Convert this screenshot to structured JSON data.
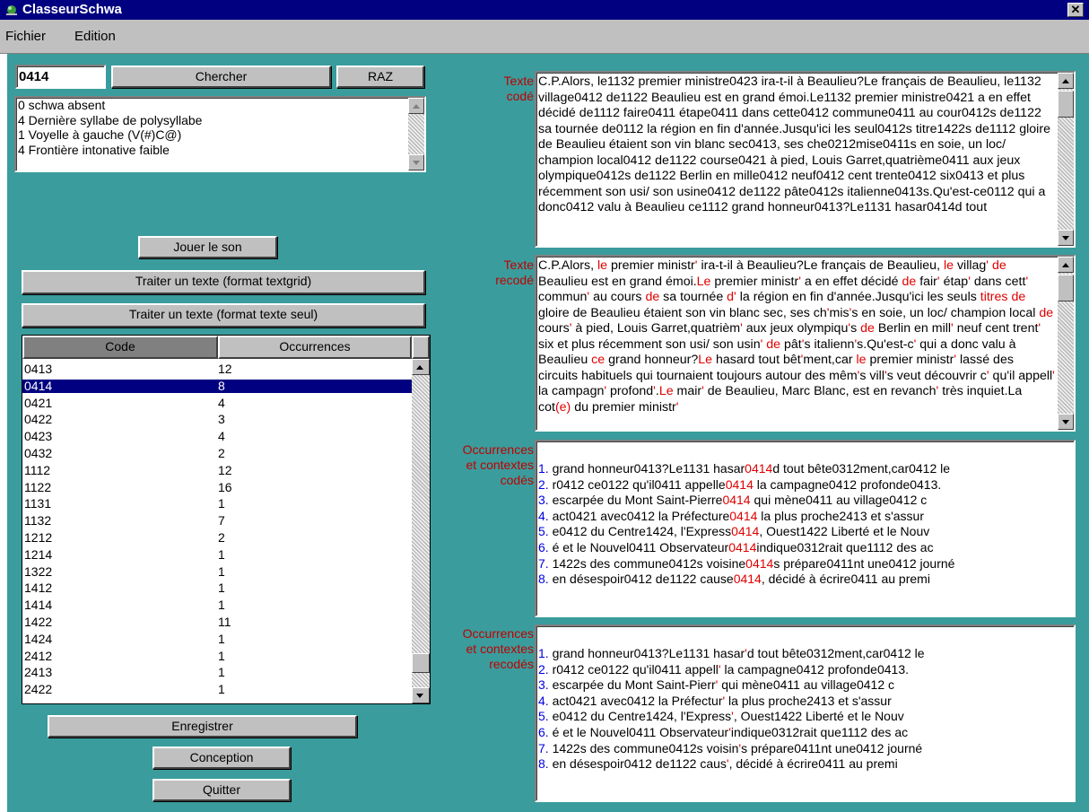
{
  "window": {
    "title": "ClasseurSchwa",
    "close_glyph": "✕"
  },
  "menu": [
    "Fichier",
    "Edition"
  ],
  "search": {
    "code_value": "0414",
    "search_label": "Chercher",
    "reset_label": "RAZ",
    "results": [
      "0 schwa absent",
      "4 Dernière syllabe de polysyllabe",
      "1 Voyelle à gauche (V(#)C@)",
      "4 Frontière intonative faible"
    ]
  },
  "buttons": {
    "play": "Jouer le son",
    "process_textgrid": "Traiter un texte (format textgrid)",
    "process_plain": "Traiter un texte (format texte seul)",
    "save": "Enregistrer",
    "design": "Conception",
    "quit": "Quitter"
  },
  "grid": {
    "headers": [
      "Code",
      "Occurrences"
    ],
    "selected_index": 1,
    "rows": [
      [
        "0413",
        "12"
      ],
      [
        "0414",
        "8"
      ],
      [
        "0421",
        "4"
      ],
      [
        "0422",
        "3"
      ],
      [
        "0423",
        "4"
      ],
      [
        "0432",
        "2"
      ],
      [
        "1112",
        "12"
      ],
      [
        "1122",
        "16"
      ],
      [
        "1131",
        "1"
      ],
      [
        "1132",
        "7"
      ],
      [
        "1212",
        "2"
      ],
      [
        "1214",
        "1"
      ],
      [
        "1322",
        "1"
      ],
      [
        "1412",
        "1"
      ],
      [
        "1414",
        "1"
      ],
      [
        "1422",
        "11"
      ],
      [
        "1424",
        "1"
      ],
      [
        "2412",
        "1"
      ],
      [
        "2413",
        "1"
      ],
      [
        "2422",
        "1"
      ]
    ]
  },
  "labels": {
    "coded_text": [
      "Texte",
      "codé"
    ],
    "recoded_text": [
      "Texte",
      "recodé"
    ],
    "coded_occ": [
      "Occurrences",
      "et contextes",
      "codés"
    ],
    "recoded_occ": [
      "Occurrences",
      "et contextes",
      "recodés"
    ]
  },
  "coded_text": "C.P.Alors, le1132 premier ministre0423 ira-t-il à Beaulieu?Le français de Beaulieu, le1132 village0412 de1122 Beaulieu est en grand émoi.Le1132 premier ministre0421 a en effet décidé de1112 faire0411 étape0411 dans cette0412 commune0411 au cour0412s de1122 sa tournée de0112 la région en fin d'année.Jusqu'ici les seul0412s titre1422s de1112 gloire de Beaulieu étaient son vin blanc sec0413, ses che0212mise0411s en soie, un loc/ champion local0412 de1122 course0421 à pied, Louis Garret,quatrième0411 aux jeux olympique0412s de1122 Berlin en mille0412 neuf0412 cent trente0412 six0413 et plus récemment son usi/ son usine0412 de1122 pâte0412s italienne0413s.Qu'est-ce0112 qui a donc0412 valu à Beaulieu ce1112 grand honneur0413?Le1131 hasar0414d tout",
  "recoded_text": [
    {
      "t": "C.P.Alors, "
    },
    {
      "t": "le",
      "r": 1
    },
    {
      "t": "  premier ministr"
    },
    {
      "t": "'",
      "r": 1
    },
    {
      "t": " ira-t-il à Beaulieu?Le français de Beaulieu, "
    },
    {
      "t": "le",
      "r": 1
    },
    {
      "t": "  villag"
    },
    {
      "t": "'",
      "r": 1
    },
    {
      "t": " "
    },
    {
      "t": "de",
      "r": 1
    },
    {
      "t": " Beaulieu est en grand émoi."
    },
    {
      "t": "Le",
      "r": 1
    },
    {
      "t": " premier ministr"
    },
    {
      "t": "'",
      "r": 1
    },
    {
      "t": " a en effet décidé "
    },
    {
      "t": "de",
      "r": 1
    },
    {
      "t": " fair"
    },
    {
      "t": "'",
      "r": 1
    },
    {
      "t": " étap"
    },
    {
      "t": "'",
      "r": 1
    },
    {
      "t": " dans cett"
    },
    {
      "t": "'",
      "r": 1
    },
    {
      "t": " commun"
    },
    {
      "t": "'",
      "r": 1
    },
    {
      "t": " au cours "
    },
    {
      "t": "de",
      "r": 1
    },
    {
      "t": " sa tournée "
    },
    {
      "t": "d'",
      "r": 1
    },
    {
      "t": " la région en fin d'année.Jusqu'ici les seuls "
    },
    {
      "t": "titres",
      "r": 1
    },
    {
      "t": " "
    },
    {
      "t": "de",
      "r": 1
    },
    {
      "t": " gloire de Beaulieu étaient son vin blanc sec, ses ch"
    },
    {
      "t": "'",
      "r": 1
    },
    {
      "t": "mis"
    },
    {
      "t": "'",
      "r": 1
    },
    {
      "t": "s en soie, un loc/ champion local "
    },
    {
      "t": "de",
      "r": 1
    },
    {
      "t": " cours"
    },
    {
      "t": "'",
      "r": 1
    },
    {
      "t": " à pied, Louis Garret,quatrièm"
    },
    {
      "t": "'",
      "r": 1
    },
    {
      "t": " aux jeux olympiqu"
    },
    {
      "t": "'",
      "r": 1
    },
    {
      "t": "s "
    },
    {
      "t": "de",
      "r": 1
    },
    {
      "t": " Berlin en mill"
    },
    {
      "t": "'",
      "r": 1
    },
    {
      "t": " neuf cent trent"
    },
    {
      "t": "'",
      "r": 1
    },
    {
      "t": " six et plus récemment son usi/ son usin"
    },
    {
      "t": "'",
      "r": 1
    },
    {
      "t": " "
    },
    {
      "t": "de",
      "r": 1
    },
    {
      "t": " pât"
    },
    {
      "t": "'",
      "r": 1
    },
    {
      "t": "s italienn"
    },
    {
      "t": "'",
      "r": 1
    },
    {
      "t": "s.Qu'est-c"
    },
    {
      "t": "'",
      "r": 1
    },
    {
      "t": " qui a donc valu à Beaulieu "
    },
    {
      "t": "ce",
      "r": 1
    },
    {
      "t": " grand honneur?"
    },
    {
      "t": "Le",
      "r": 1
    },
    {
      "t": " hasard tout bêt"
    },
    {
      "t": "'",
      "r": 1
    },
    {
      "t": "ment,car "
    },
    {
      "t": "le",
      "r": 1
    },
    {
      "t": " premier ministr"
    },
    {
      "t": "'",
      "r": 1
    },
    {
      "t": " lassé des circuits habituels qui tournaient toujours autour des mêm"
    },
    {
      "t": "'",
      "r": 1
    },
    {
      "t": "s vill"
    },
    {
      "t": "'",
      "r": 1
    },
    {
      "t": "s veut découvrir c"
    },
    {
      "t": "'",
      "r": 1
    },
    {
      "t": " qu'il appell"
    },
    {
      "t": "'",
      "r": 1
    },
    {
      "t": " la campagn"
    },
    {
      "t": "'",
      "r": 1
    },
    {
      "t": " profond"
    },
    {
      "t": "'",
      "r": 1
    },
    {
      "t": "."
    },
    {
      "t": "Le",
      "r": 1
    },
    {
      "t": " mair"
    },
    {
      "t": "'",
      "r": 1
    },
    {
      "t": " de Beaulieu, Marc Blanc, est en revanch"
    },
    {
      "t": "'",
      "r": 1
    },
    {
      "t": " très inquiet.La cot"
    },
    {
      "t": "(e)",
      "r": 1
    },
    {
      "t": " du premier ministr"
    },
    {
      "t": "'",
      "r": 1
    }
  ],
  "coded_occurrences": [
    [
      {
        "t": "1.",
        "b": 1
      },
      {
        "t": " grand honneur0413?Le1131 hasar"
      },
      {
        "t": "0414",
        "r": 1
      },
      {
        "t": "d tout bête0312ment,car0412 le"
      }
    ],
    [
      {
        "t": "2.",
        "b": 1
      },
      {
        "t": " r0412 ce0122 qu'il0411 appelle"
      },
      {
        "t": "0414",
        "r": 1
      },
      {
        "t": " la campagne0412 profonde0413."
      }
    ],
    [
      {
        "t": "3.",
        "b": 1
      },
      {
        "t": "  escarpée du Mont Saint-Pierre"
      },
      {
        "t": "0414",
        "r": 1
      },
      {
        "t": " qui mène0411 au village0412 c"
      }
    ],
    [
      {
        "t": "4.",
        "b": 1
      },
      {
        "t": " act0421 avec0412 la Préfecture"
      },
      {
        "t": "0414",
        "r": 1
      },
      {
        "t": " la plus proche2413 et s'assur"
      }
    ],
    [
      {
        "t": "5.",
        "b": 1
      },
      {
        "t": " e0412 du Centre1424, l'Express"
      },
      {
        "t": "0414",
        "r": 1
      },
      {
        "t": ", Ouest1422 Liberté et le Nouv"
      }
    ],
    [
      {
        "t": "6.",
        "b": 1
      },
      {
        "t": " é et le Nouvel0411 Observateur"
      },
      {
        "t": "0414",
        "r": 1
      },
      {
        "t": "indique0312rait que1112 des ac"
      }
    ],
    [
      {
        "t": "7.",
        "b": 1
      },
      {
        "t": " 1422s des commune0412s voisine"
      },
      {
        "t": "0414",
        "r": 1
      },
      {
        "t": "s prépare0411nt une0412 journé"
      }
    ],
    [
      {
        "t": "8.",
        "b": 1
      },
      {
        "t": "  en désespoir0412 de1122 cause"
      },
      {
        "t": "0414",
        "r": 1
      },
      {
        "t": ", décidé à écrire0411 au premi"
      }
    ]
  ],
  "recoded_occurrences": [
    [
      {
        "t": "1.",
        "b": 1
      },
      {
        "t": " grand honneur0413?Le1131 hasar"
      },
      {
        "t": "'",
        "r": 1
      },
      {
        "t": "d tout bête0312ment,car0412 le"
      }
    ],
    [
      {
        "t": "2.",
        "b": 1
      },
      {
        "t": " r0412 ce0122 qu'il0411 appell"
      },
      {
        "t": "'",
        "r": 1
      },
      {
        "t": " la campagne0412 profonde0413."
      }
    ],
    [
      {
        "t": "3.",
        "b": 1
      },
      {
        "t": "  escarpée du Mont Saint-Pierr"
      },
      {
        "t": "'",
        "r": 1
      },
      {
        "t": " qui mène0411 au village0412 c"
      }
    ],
    [
      {
        "t": "4.",
        "b": 1
      },
      {
        "t": " act0421 avec0412 la Préfectur"
      },
      {
        "t": "'",
        "r": 1
      },
      {
        "t": " la plus proche2413 et s'assur"
      }
    ],
    [
      {
        "t": "5.",
        "b": 1
      },
      {
        "t": " e0412 du Centre1424, l'Express"
      },
      {
        "t": "'",
        "r": 1
      },
      {
        "t": ", Ouest1422 Liberté et le Nouv"
      }
    ],
    [
      {
        "t": "6.",
        "b": 1
      },
      {
        "t": " é et le Nouvel0411 Observateur"
      },
      {
        "t": "'",
        "r": 1
      },
      {
        "t": "indique0312rait que1112 des ac"
      }
    ],
    [
      {
        "t": "7.",
        "b": 1
      },
      {
        "t": " 1422s des commune0412s voisin"
      },
      {
        "t": "'",
        "r": 1
      },
      {
        "t": "s prépare0411nt une0412 journé"
      }
    ],
    [
      {
        "t": "8.",
        "b": 1
      },
      {
        "t": "  en désespoir0412 de1122 caus"
      },
      {
        "t": "'",
        "r": 1
      },
      {
        "t": ", décidé à écrire0411 au premi"
      }
    ]
  ],
  "colors": {
    "client_bg": "#3a9c9c",
    "titlebar": "#000080",
    "label_red": "#c00000",
    "mark_red": "#e00000",
    "number_blue": "#0000e0",
    "selection": "#000080"
  },
  "icons": {
    "app": "app-icon",
    "close": "close-icon"
  }
}
